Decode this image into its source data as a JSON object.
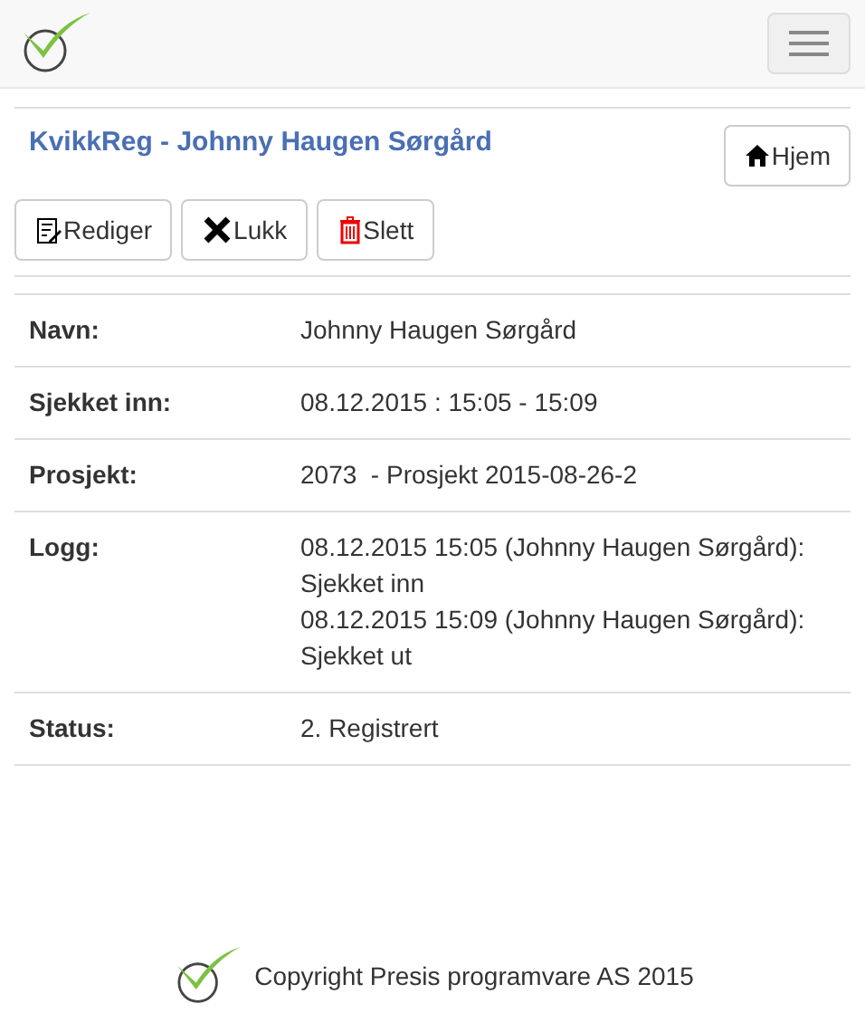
{
  "title": "KvikkReg - Johnny Haugen Sørgård",
  "home_button": "Hjem",
  "actions": [
    {
      "kind": "edit",
      "label": "Rediger"
    },
    {
      "kind": "close",
      "label": "Lukk"
    },
    {
      "kind": "delete",
      "label": "Slett"
    }
  ],
  "details": [
    {
      "label": "Navn:",
      "lines": [
        "Johnny Haugen Sørgård"
      ]
    },
    {
      "label": "Sjekket inn:",
      "lines": [
        "08.12.2015 : 15:05 - 15:09"
      ]
    },
    {
      "label": "Prosjekt:",
      "lines": [
        "2073  - Prosjekt 2015-08-26-2"
      ]
    },
    {
      "label": "Logg:",
      "lines": [
        "08.12.2015 15:05 (Johnny Haugen Sørgård):",
        "Sjekket inn",
        "08.12.2015 15:09 (Johnny Haugen Sørgård):",
        "Sjekket ut"
      ]
    },
    {
      "label": "Status:",
      "lines": [
        "2. Registrert"
      ]
    }
  ],
  "footer": "Copyright Presis programvare AS 2015"
}
